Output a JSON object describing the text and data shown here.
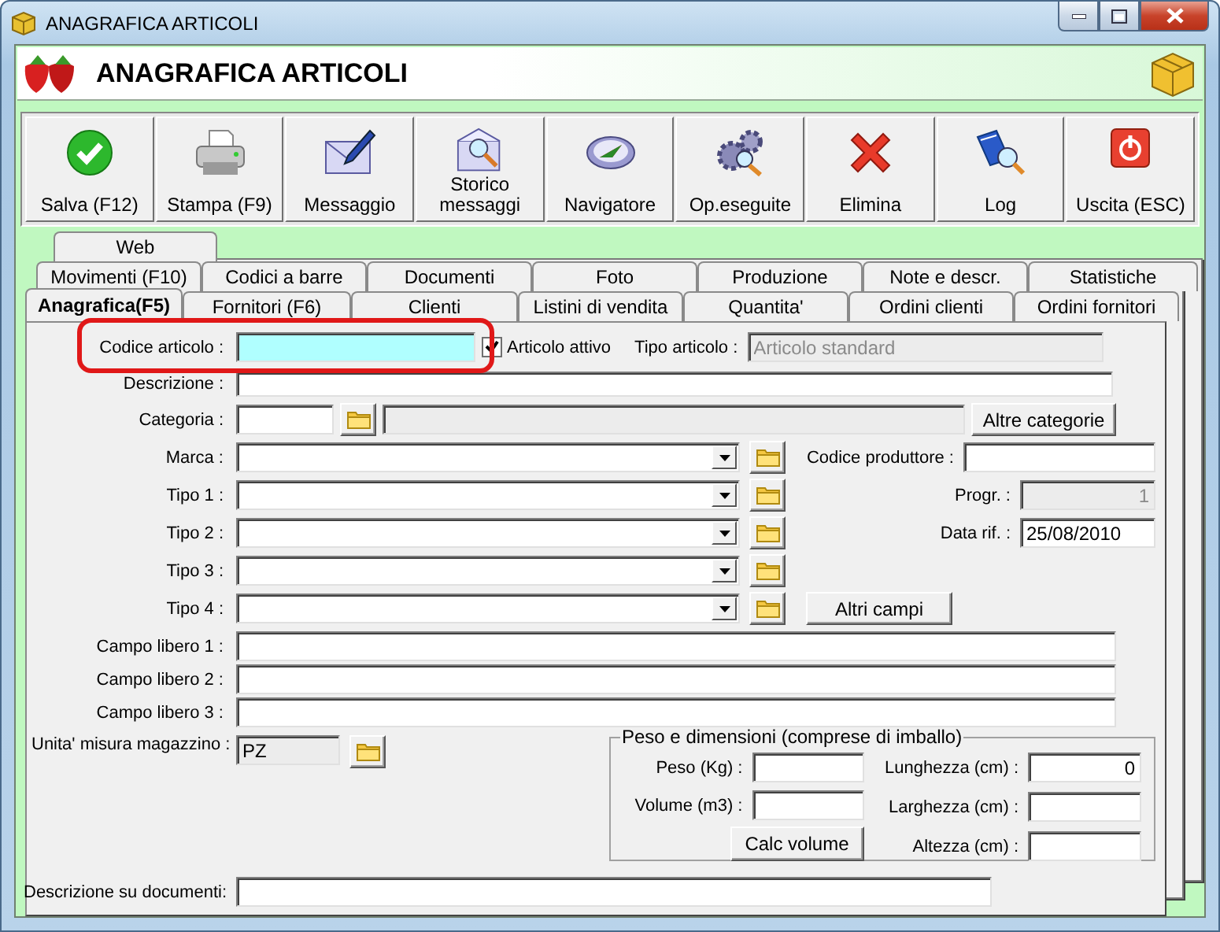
{
  "window": {
    "title": "ANAGRAFICA ARTICOLI"
  },
  "header": {
    "title": "ANAGRAFICA ARTICOLI"
  },
  "toolbar": [
    {
      "label": "Salva (F12)"
    },
    {
      "label": "Stampa (F9)"
    },
    {
      "label": "Messaggio"
    },
    {
      "label": "Storico messaggi"
    },
    {
      "label": "Navigatore"
    },
    {
      "label": "Op.eseguite"
    },
    {
      "label": "Elimina"
    },
    {
      "label": "Log"
    },
    {
      "label": "Uscita (ESC)"
    }
  ],
  "tab_rows": [
    [
      {
        "label": "Web",
        "selected": false
      }
    ],
    [
      {
        "label": "Movimenti (F10)",
        "selected": false
      },
      {
        "label": "Codici a barre",
        "selected": false
      },
      {
        "label": "Documenti",
        "selected": false
      },
      {
        "label": "Foto",
        "selected": false
      },
      {
        "label": "Produzione",
        "selected": false
      },
      {
        "label": "Note e descr.",
        "selected": false
      },
      {
        "label": "Statistiche",
        "selected": false
      }
    ],
    [
      {
        "label": "Anagrafica(F5)",
        "selected": true
      },
      {
        "label": "Fornitori (F6)",
        "selected": false
      },
      {
        "label": "Clienti",
        "selected": false
      },
      {
        "label": "Listini di vendita",
        "selected": false
      },
      {
        "label": "Quantita'",
        "selected": false
      },
      {
        "label": "Ordini clienti",
        "selected": false
      },
      {
        "label": "Ordini fornitori",
        "selected": false
      }
    ]
  ],
  "form": {
    "codice_articolo": {
      "label": "Codice articolo :",
      "focused": true
    },
    "articolo_attivo": {
      "label": "Articolo attivo",
      "checked": true
    },
    "tipo_articolo": {
      "label": "Tipo articolo :",
      "value": "Articolo standard",
      "disabled": true
    },
    "descrizione": {
      "label": "Descrizione :"
    },
    "categoria": {
      "label": "Categoria :",
      "button": "Altre categorie"
    },
    "combos": [
      {
        "label": "Marca :",
        "side": {
          "kind": "field",
          "label": "Codice produttore :"
        }
      },
      {
        "label": "Tipo 1 :",
        "side": {
          "kind": "field",
          "label": "Progr. :",
          "value": "1",
          "disabled": true
        }
      },
      {
        "label": "Tipo 2 :",
        "side": {
          "kind": "field",
          "label": "Data rif. :",
          "value": "25/08/2010"
        }
      },
      {
        "label": "Tipo 3 :"
      },
      {
        "label": "Tipo 4 :",
        "side": {
          "kind": "button",
          "label": "Altri campi"
        }
      }
    ],
    "campi_liberi": [
      {
        "label": "Campo libero 1 :"
      },
      {
        "label": "Campo libero 2 :"
      },
      {
        "label": "Campo libero 3 :"
      }
    ],
    "unita_misura": {
      "label": "Unita' misura magazzino :",
      "value": "PZ",
      "readonly": true
    },
    "peso_dimensioni": {
      "title": "Peso e dimensioni (comprese di imballo)",
      "left": [
        {
          "label": "Peso (Kg) :"
        },
        {
          "label": "Volume (m3) :"
        }
      ],
      "button": "Calc volume",
      "right": [
        {
          "label": "Lunghezza (cm) :",
          "value": "0"
        },
        {
          "label": "Larghezza (cm) :"
        },
        {
          "label": "Altezza (cm) :"
        }
      ]
    },
    "descrizione_documenti": {
      "label": "Descrizione su documenti:"
    }
  }
}
